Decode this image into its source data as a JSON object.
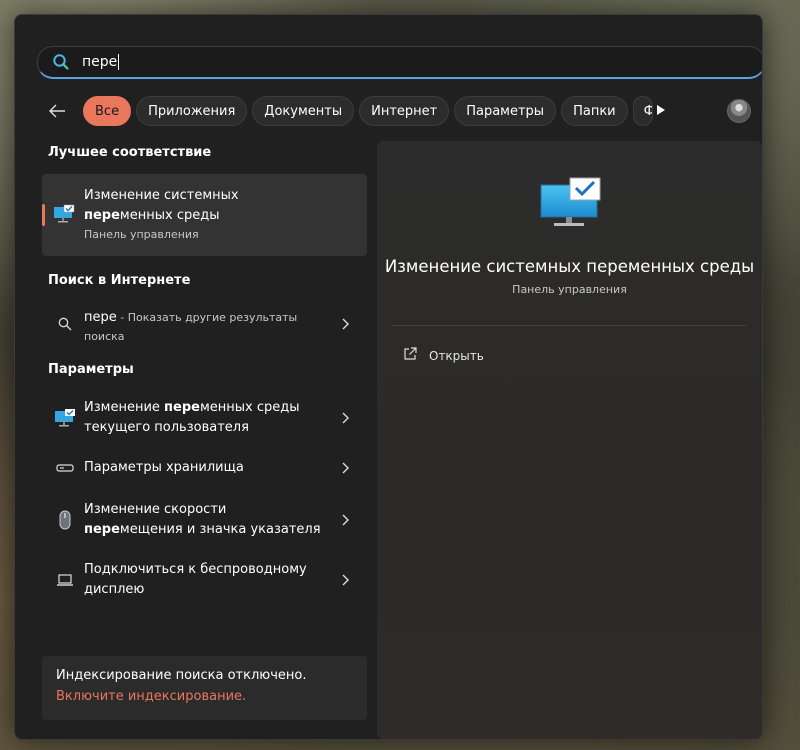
{
  "search": {
    "query": "пере"
  },
  "filters": [
    "Все",
    "Приложения",
    "Документы",
    "Интернет",
    "Параметры",
    "Папки",
    "Ф"
  ],
  "best_match": {
    "heading": "Лучшее соответствие",
    "title_line1": "Изменение системных",
    "title_bold": "пере",
    "title_line2_rest": "менных среды",
    "subtitle": "Панель управления",
    "icon": "monitor-check-icon"
  },
  "web": {
    "heading": "Поиск в Интернете",
    "query": "пере",
    "suffix": " - Показать другие результаты",
    "suffix2": "поиска"
  },
  "settings": {
    "heading": "Параметры",
    "items": [
      {
        "pre": "Изменение ",
        "bold": "пере",
        "post": "менных среды",
        "line2": "текущего пользователя",
        "icon": "monitor-check-icon"
      },
      {
        "pre": "Параметры хранилища",
        "bold": "",
        "post": "",
        "line2": "",
        "icon": "storage-icon"
      },
      {
        "pre": "Изменение скорости",
        "bold": "",
        "post": "",
        "line2_bold": "пере",
        "line2": "мещения и значка указателя",
        "icon": "mouse-icon"
      },
      {
        "pre": "Подключиться к беспроводному",
        "bold": "",
        "post": "",
        "line2": "дисплею",
        "icon": "laptop-icon"
      }
    ]
  },
  "index_notice": {
    "text": "Индексирование поиска отключено.",
    "link": "Включите индексирование."
  },
  "preview": {
    "title": "Изменение системных переменных среды",
    "subtitle": "Панель управления",
    "open_label": "Открыть"
  },
  "colors": {
    "accent": "#e8775c",
    "panel": "#202020"
  }
}
